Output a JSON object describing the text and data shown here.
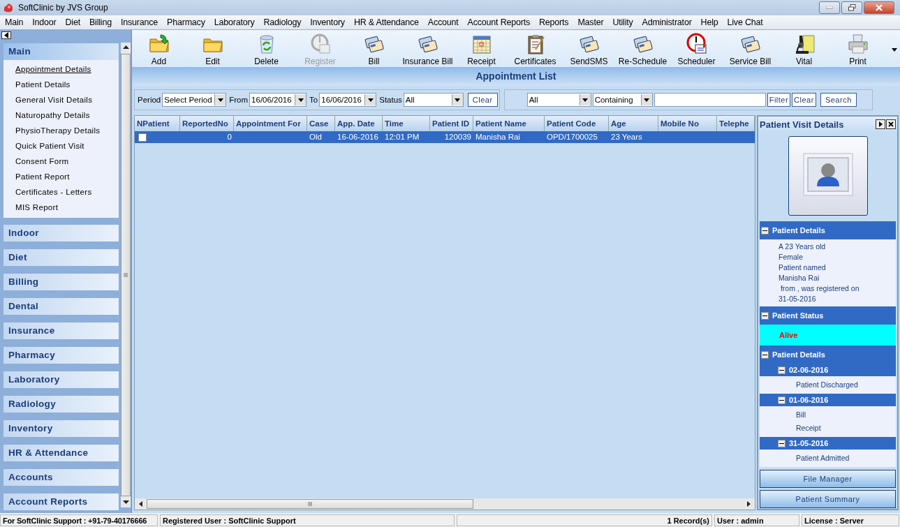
{
  "window": {
    "title": "SoftClinic by JVS Group"
  },
  "menu": [
    "Main",
    "Indoor",
    "Diet",
    "Billing",
    "Insurance",
    "Pharmacy",
    "Laboratory",
    "Radiology",
    "Inventory",
    "HR & Attendance",
    "Account",
    "Account Reports",
    "Reports",
    "Master",
    "Utility",
    "Administrator",
    "Help",
    "Live Chat"
  ],
  "sidebar": {
    "groups": [
      {
        "label": "Main",
        "expanded": true,
        "items": [
          {
            "label": "Appointment Details",
            "selected": true
          },
          {
            "label": "Patient Details",
            "selected": false
          },
          {
            "label": "General Visit Details",
            "selected": false
          },
          {
            "label": "Naturopathy Details",
            "selected": false
          },
          {
            "label": "PhysioTherapy Details",
            "selected": false
          },
          {
            "label": "Quick Patient Visit",
            "selected": false
          },
          {
            "label": "Consent Form",
            "selected": false
          },
          {
            "label": "Patient Report",
            "selected": false
          },
          {
            "label": "Certificates - Letters",
            "selected": false
          },
          {
            "label": "MIS Report",
            "selected": false
          }
        ]
      },
      {
        "label": "Indoor",
        "expanded": false
      },
      {
        "label": "Diet",
        "expanded": false
      },
      {
        "label": "Billing",
        "expanded": false
      },
      {
        "label": "Dental",
        "expanded": false
      },
      {
        "label": "Insurance",
        "expanded": false
      },
      {
        "label": "Pharmacy",
        "expanded": false
      },
      {
        "label": "Laboratory",
        "expanded": false
      },
      {
        "label": "Radiology",
        "expanded": false
      },
      {
        "label": "Inventory",
        "expanded": false
      },
      {
        "label": "HR & Attendance",
        "expanded": false
      },
      {
        "label": "Accounts",
        "expanded": false
      },
      {
        "label": "Account Reports",
        "expanded": false
      }
    ]
  },
  "toolbar": [
    {
      "label": "Add",
      "kind": "add",
      "disabled": false
    },
    {
      "label": "Edit",
      "kind": "edit",
      "disabled": false
    },
    {
      "label": "Delete",
      "kind": "delete",
      "disabled": false
    },
    {
      "label": "Register",
      "kind": "register",
      "disabled": true
    },
    {
      "label": "Bill",
      "kind": "bill",
      "disabled": false
    },
    {
      "label": "Insurance Bill",
      "kind": "bill",
      "disabled": false
    },
    {
      "label": "Receipt",
      "kind": "receipt",
      "disabled": false
    },
    {
      "label": "Certificates",
      "kind": "certificate",
      "disabled": false
    },
    {
      "label": "SendSMS",
      "kind": "bill",
      "disabled": false
    },
    {
      "label": "Re-Schedule",
      "kind": "bill",
      "disabled": false
    },
    {
      "label": "Scheduler",
      "kind": "schedule",
      "disabled": false
    },
    {
      "label": "Service Bill",
      "kind": "bill",
      "disabled": false
    },
    {
      "label": "Vital",
      "kind": "vital",
      "disabled": false
    },
    {
      "label": "Print",
      "kind": "print",
      "disabled": false
    }
  ],
  "list_title": "Appointment List",
  "filters": {
    "period_label": "Period",
    "period": "Select Period",
    "from_label": "From",
    "from": "16/06/2016",
    "to_label": "To",
    "to": "16/06/2016",
    "status_label": "Status",
    "status": "All",
    "clear": "Clear",
    "field": "All",
    "match": "Containing",
    "filter": "Filter",
    "clear_search": "Clear",
    "search": "Search"
  },
  "table": {
    "columns": [
      "NPatient",
      "ReportedNo",
      "Appointment For",
      "Case",
      "App. Date",
      "Time",
      "Patient ID",
      "Patient Name",
      "Patient Code",
      "Age",
      "Mobile No",
      "Telephe"
    ],
    "rows": [
      {
        "selected": true,
        "checked": false,
        "cells": [
          "",
          "0",
          "",
          "Old",
          "16-06-2016",
          "12:01 PM",
          "120039",
          "Manisha Rai",
          "OPD/1700025",
          "23 Years",
          "",
          ""
        ]
      }
    ]
  },
  "visit_panel": {
    "title": "Patient Visit Details",
    "sections": [
      {
        "kind": "text",
        "title": "Patient Details",
        "expanded": true,
        "lines": [
          "A 23 Years old",
          "Female",
          "Patient named",
          "Manisha Rai",
          " from , was registered on",
          "31-05-2016"
        ]
      },
      {
        "kind": "status",
        "title": "Patient Status",
        "expanded": true,
        "status": "Alive"
      },
      {
        "kind": "history",
        "title": "Patient Details",
        "expanded": true,
        "children": [
          {
            "date": "02-06-2016",
            "expanded": true,
            "children": [
              "Patient Discharged"
            ]
          },
          {
            "date": "01-06-2016",
            "expanded": true,
            "children": [
              "Bill",
              "Receipt"
            ]
          },
          {
            "date": "31-05-2016",
            "expanded": true,
            "children": [
              "Patient Admitted"
            ]
          }
        ]
      }
    ],
    "buttons": [
      "File Manager",
      "Patient Summary"
    ]
  },
  "status_bar": [
    "For SoftClinic Support : +91-79-40176666",
    "Registered User : SoftClinic Support",
    "1 Record(s)",
    "User : admin",
    "License : Server"
  ]
}
